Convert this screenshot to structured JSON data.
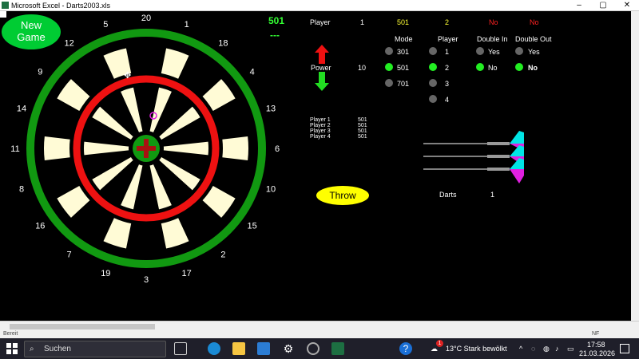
{
  "window": {
    "title": "Microsoft Excel - Darts2003.xls"
  },
  "buttons": {
    "new_game_line1": "New",
    "new_game_line2": "Game",
    "throw": "Throw"
  },
  "scoreboard": {
    "remaining": "501",
    "dash": "---"
  },
  "header": {
    "player_label": "Player",
    "player_no": "1",
    "mode": "501",
    "player_count": "2",
    "double_in": "No",
    "double_out": "No"
  },
  "power": {
    "label": "Power",
    "value": "10"
  },
  "options": {
    "mode_title": "Mode",
    "player_title": "Player",
    "double_in_title": "Double In",
    "double_out_title": "Double Out",
    "modes": [
      "301",
      "501",
      "701"
    ],
    "players": [
      "1",
      "2",
      "3",
      "4"
    ],
    "di": [
      "Yes",
      "No"
    ],
    "do": [
      "Yes",
      "No"
    ]
  },
  "scores": [
    {
      "name": "Player 1",
      "score": "501"
    },
    {
      "name": "Player 2",
      "score": "501"
    },
    {
      "name": "Player 3",
      "score": "501"
    },
    {
      "name": "Player 4",
      "score": "501"
    }
  ],
  "darts": {
    "label": "Darts",
    "count": "1"
  },
  "board_numbers": [
    "20",
    "1",
    "18",
    "4",
    "13",
    "6",
    "10",
    "15",
    "2",
    "17",
    "3",
    "19",
    "7",
    "16",
    "8",
    "11",
    "14",
    "9",
    "12",
    "5"
  ],
  "status": {
    "left": "Bereit",
    "right": "NF"
  },
  "taskbar": {
    "search": "Suchen",
    "weather": "13°C  Stark bewölkt",
    "time": "17:58",
    "date": "21.03.2026",
    "badge": "1"
  },
  "colors": {
    "green": "#119911",
    "red": "#ee1111",
    "cream": "#fffbd6",
    "black": "#000000",
    "bull_red": "#aa1111"
  }
}
